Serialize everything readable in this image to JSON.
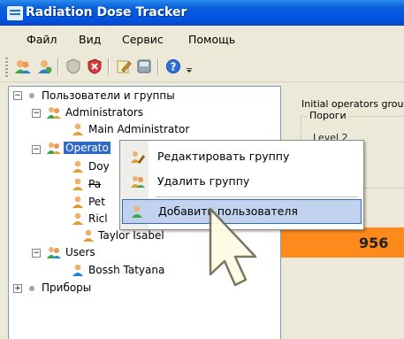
{
  "window": {
    "title": "Radiation Dose Tracker"
  },
  "menu": [
    "Файл",
    "Вид",
    "Сервис",
    "Помощь"
  ],
  "toolbar": {
    "buttons": [
      "users-add-icon",
      "user-icon",
      "shield-icon",
      "shield-delete-icon",
      "edit-icon",
      "device-icon",
      "help-icon",
      "overflow-icon"
    ]
  },
  "tree": {
    "root_users": "Пользователи и группы",
    "groups": [
      {
        "name": "Administrators",
        "members": [
          "Main Administrator"
        ]
      },
      {
        "name": "Operato",
        "members": [
          "Doy",
          "Pa",
          "Pet",
          "Ricl",
          "Taylor Isabel"
        ]
      },
      {
        "name": "Users",
        "members": [
          "Bossh Tatyana"
        ]
      }
    ],
    "root_devices": "Приборы"
  },
  "right_panel": {
    "group_title": "Initial operators grou",
    "thresholds_legend": "Пороги",
    "level_label": "Level  2",
    "value": "956",
    "accent_color": "#ff8a1c"
  },
  "context_menu": {
    "items": [
      {
        "label": "Редактировать группу",
        "icon": "edit-group-icon"
      },
      {
        "label": "Удалить группу",
        "icon": "delete-group-icon"
      },
      {
        "label": "Добавить пользователя",
        "icon": "add-user-icon",
        "highlighted": true
      }
    ]
  }
}
